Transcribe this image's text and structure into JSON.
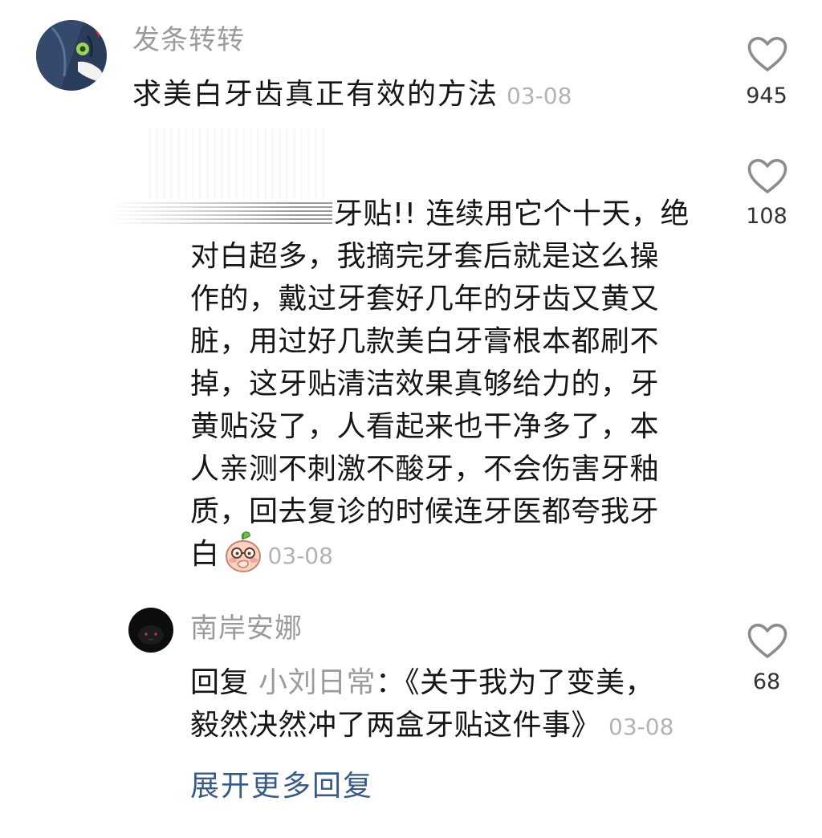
{
  "comments": [
    {
      "username": "发条转转",
      "avatar_icon": "user-avatar",
      "lines": [
        "求美白牙齿真正有效的方法"
      ],
      "date": "03-08",
      "like_icon": "heart-outline-icon",
      "like_count": "945"
    },
    {
      "lines": [
        "牙贴!! 连续用它个十天，绝",
        "对白超多，我摘完牙套后就是这么操",
        "作的，戴过牙套好几年的牙齿又黄又",
        "脏，用过好几款美白牙膏根本都刷不",
        "掉，这牙贴清洁效果真够给力的，牙",
        "黄贴没了，人看起来也干净多了，本",
        "人亲测不刺激不酸牙，不会伤害牙釉",
        "质，回去复诊的时候连牙医都夸我牙",
        "白"
      ],
      "emoji": "blushing-peach-emoji",
      "date": "03-08",
      "like_icon": "heart-outline-icon",
      "like_count": "108"
    },
    {
      "username": "南岸安娜",
      "avatar_icon": "user-avatar",
      "reply_label": "回复",
      "reply_to": "小刘日常",
      "lines": [
        "：《关于我为了变美，",
        "毅然决然冲了两盒牙贴这件事》"
      ],
      "date": "03-08",
      "like_icon": "heart-outline-icon",
      "like_count": "68"
    }
  ],
  "expand_replies_label": "展开更多回复",
  "colors": {
    "text": "#161616",
    "username": "#9b9b9b",
    "date": "#b3b3b3",
    "count": "#333333",
    "link": "#385a86",
    "icon": "#8c8c8c"
  }
}
